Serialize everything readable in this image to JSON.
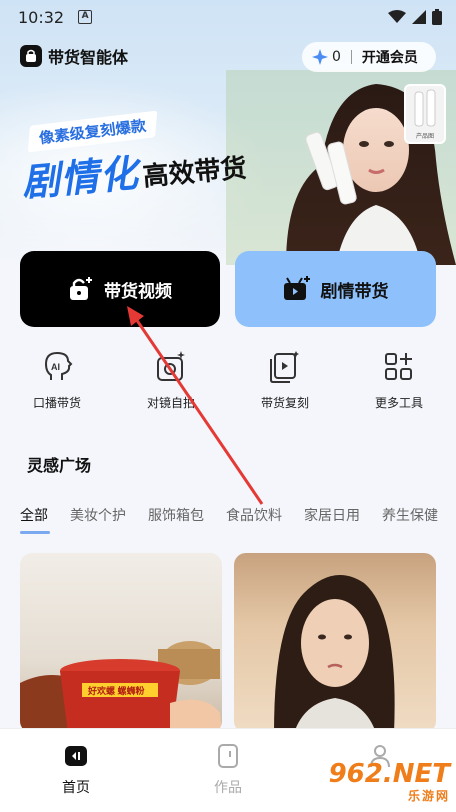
{
  "status_bar": {
    "time": "10:32",
    "a_badge": "A"
  },
  "header": {
    "app_title": "带货智能体",
    "vip_count": "0",
    "vip_label": "开通会员"
  },
  "banner": {
    "tag": "像素级复刻爆款",
    "headline_big": "剧情化",
    "headline_small": "高效带货",
    "product_label": "产品图"
  },
  "main_actions": [
    {
      "label": "带货视频",
      "icon": "lock-plus-icon"
    },
    {
      "label": "剧情带货",
      "icon": "tv-plus-icon"
    }
  ],
  "tools": [
    {
      "label": "口播带货",
      "icon": "ai-head-icon"
    },
    {
      "label": "对镜自拍",
      "icon": "camera-sparkle-icon"
    },
    {
      "label": "带货复刻",
      "icon": "video-copy-icon"
    },
    {
      "label": "更多工具",
      "icon": "grid-plus-icon"
    }
  ],
  "inspiration": {
    "title": "灵感广场",
    "tabs": [
      "全部",
      "美妆个护",
      "服饰箱包",
      "食品饮料",
      "家居日用",
      "养生保健"
    ],
    "active_tab": "全部",
    "cards": [
      {
        "label": "好欢螺 螺蛳粉"
      },
      {
        "label": ""
      }
    ]
  },
  "bottom_nav": [
    {
      "label": "首页",
      "icon": "home-icon",
      "active": true
    },
    {
      "label": "作品",
      "icon": "works-icon",
      "active": false
    },
    {
      "label": "",
      "icon": "profile-icon",
      "active": false
    }
  ],
  "watermark": {
    "big": "962.NET",
    "small": "乐游网"
  },
  "colors": {
    "primary_blue": "#1f6fe8",
    "light_blue_button": "#8ec0fb",
    "arrow_red": "#e53935",
    "watermark_orange": "#ef7d1a"
  }
}
